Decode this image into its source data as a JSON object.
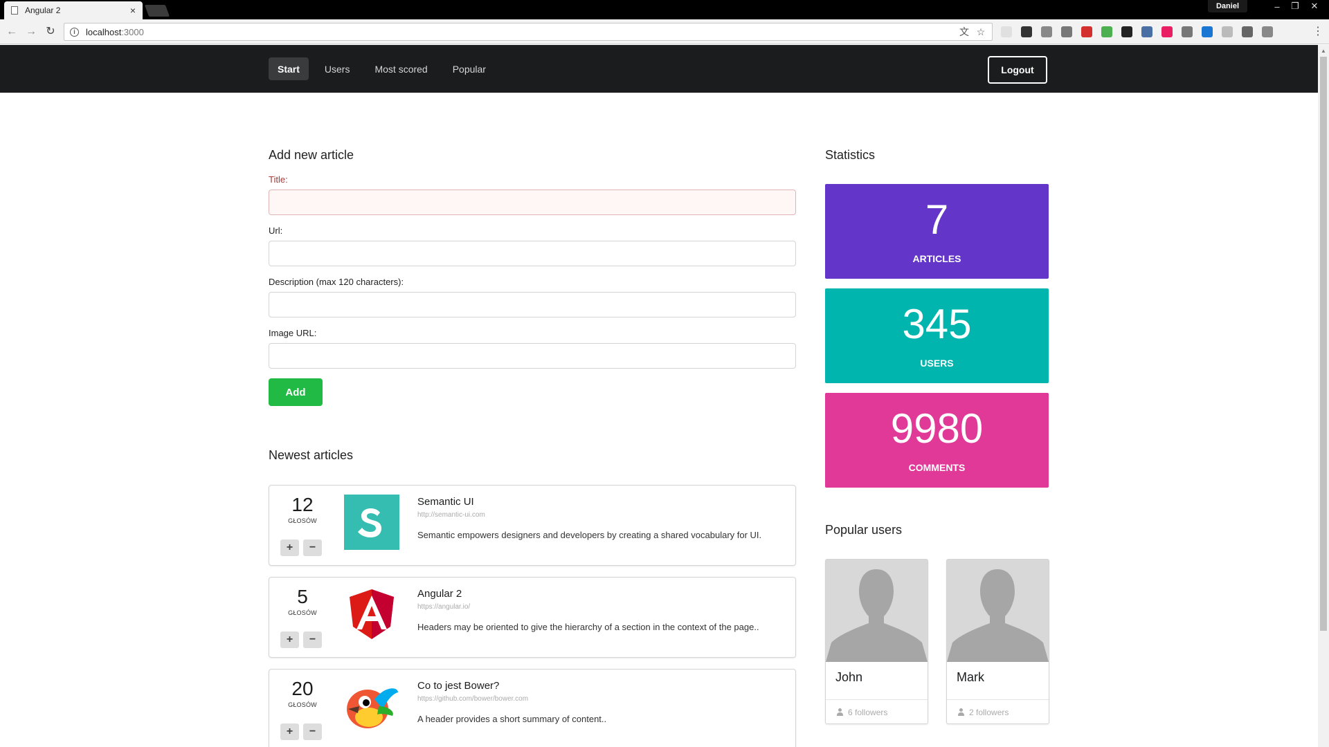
{
  "browser": {
    "tab_title": "Angular 2",
    "tab_close": "×",
    "profile": "Daniel",
    "url_host": "localhost",
    "url_port": ":3000",
    "extension_colors": [
      "#e0e0e0",
      "#333333",
      "#888888",
      "#777777",
      "#d32f2f",
      "#4caf50",
      "#222222",
      "#4a6fa5",
      "#e91e63",
      "#777777",
      "#1976d2",
      "#bbbbbb",
      "#666666",
      "#888888"
    ]
  },
  "nav": {
    "items": [
      "Start",
      "Users",
      "Most scored",
      "Popular"
    ],
    "active_index": 0,
    "logout_label": "Logout"
  },
  "form": {
    "heading": "Add new article",
    "title_label": "Title:",
    "url_label": "Url:",
    "description_label": "Description (max 120 characters):",
    "image_label": "Image URL:",
    "title_value": "",
    "url_value": "",
    "description_value": "",
    "image_value": "",
    "add_label": "Add"
  },
  "newest": {
    "heading": "Newest articles",
    "votes_label": "GŁOSÓW",
    "plus": "+",
    "minus": "−",
    "articles": [
      {
        "votes": "12",
        "title": "Semantic UI",
        "url": "http://semantic-ui.com",
        "description": "Semantic empowers designers and developers by creating a shared vocabulary for UI.",
        "logo": "semantic-ui-logo",
        "logo_color": "#35bdb2"
      },
      {
        "votes": "5",
        "title": "Angular 2",
        "url": "https://angular.io/",
        "description": "Headers may be oriented to give the hierarchy of a section in the context of the page..",
        "logo": "angular-logo",
        "logo_color": "#dd1b16"
      },
      {
        "votes": "20",
        "title": "Co to jest Bower?",
        "url": "https://github.com/bower/bower.com",
        "description": "A header provides a short summary of content..",
        "logo": "bower-logo",
        "logo_color": "#ef5734"
      }
    ]
  },
  "statistics": {
    "heading": "Statistics",
    "cards": [
      {
        "value": "7",
        "label": "ARTICLES",
        "color": "#6435c9"
      },
      {
        "value": "345",
        "label": "USERS",
        "color": "#00b5ad"
      },
      {
        "value": "9980",
        "label": "COMMENTS",
        "color": "#e03997"
      }
    ]
  },
  "popular_users": {
    "heading": "Popular users",
    "users": [
      {
        "name": "John",
        "followers": "6 followers"
      },
      {
        "name": "Mark",
        "followers": "2 followers"
      }
    ]
  }
}
